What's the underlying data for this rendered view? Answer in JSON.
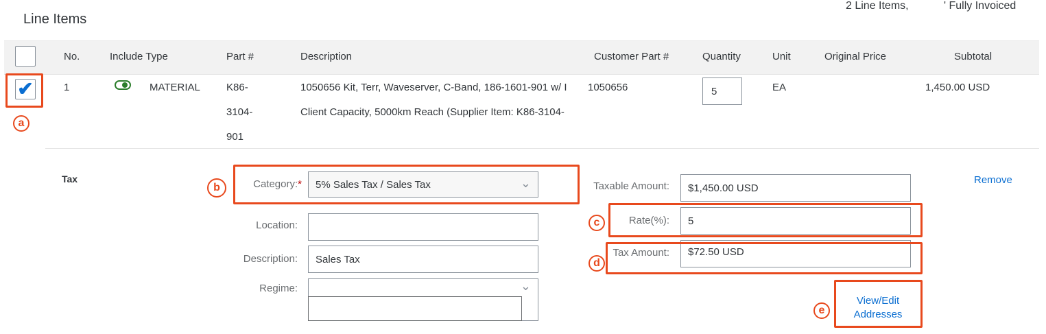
{
  "section": {
    "title": "Line Items"
  },
  "summary": {
    "line_items": "2 Line Items,",
    "status": "' Fully Invoiced"
  },
  "columns": {
    "no": "No.",
    "include_type": "Include Type",
    "part": "Part #",
    "description": "Description",
    "customer_part": "Customer Part #",
    "quantity": "Quantity",
    "unit": "Unit",
    "original_price": "Original Price",
    "subtotal": "Subtotal"
  },
  "row": {
    "no": "1",
    "include": "on",
    "type": "MATERIAL",
    "part_lines": [
      "K86-",
      "3104-",
      "901"
    ],
    "description_lines": [
      "1050656 Kit, Terr, Waveserver, C-Band, 186-1601-901 w/ I",
      "Client Capacity, 5000km Reach (Supplier Item: K86-3104-"
    ],
    "customer_part": "1050656",
    "quantity": "5",
    "unit": "EA",
    "original_price": "",
    "subtotal": "1,450.00 USD",
    "selected": true
  },
  "tax": {
    "heading": "Tax",
    "category_label": "Category:",
    "required_mark": "*",
    "category_value": "5% Sales Tax / Sales Tax",
    "location_label": "Location:",
    "location_value": "",
    "description_label": "Description:",
    "description_value": "Sales Tax",
    "regime_label": "Regime:",
    "regime_value": "",
    "regime_extra_value": "",
    "taxable_label": "Taxable Amount:",
    "taxable_value": "$1,450.00 USD",
    "rate_label": "Rate(%):",
    "rate_value": "5",
    "amount_label": "Tax Amount:",
    "amount_value": "$72.50 USD",
    "remove_label": "Remove",
    "view_edit_line1": "View/Edit",
    "view_edit_line2": "Addresses"
  },
  "annotations": [
    "a",
    "b",
    "c",
    "d",
    "e"
  ],
  "icons": {
    "dropdown": "chevron-down-icon",
    "check": "checkmark-icon",
    "toggle": "toggle-on-icon"
  },
  "colors": {
    "annotation": "#e8491d",
    "link": "#0a6ed1",
    "toggle": "#2b7d2b",
    "required": "#bb0000"
  }
}
